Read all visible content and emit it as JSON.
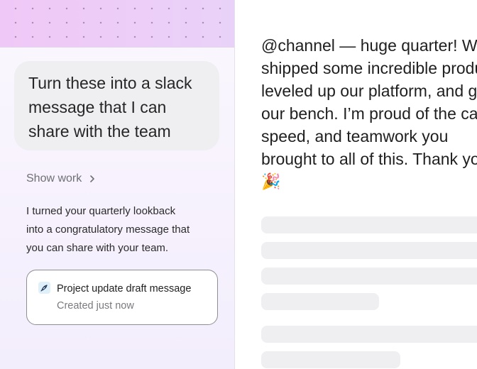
{
  "left": {
    "prompt_lines": [
      "Turn these into a slack",
      "message that I can",
      "share with the team"
    ],
    "show_work_label": "Show work",
    "assistant_lines": [
      "I turned your quarterly lookback",
      "into a congratulatory message that",
      "you can share with your team."
    ],
    "artifact": {
      "title": "Project update draft message",
      "subtitle": "Created just now",
      "icon": "rocket-icon"
    }
  },
  "right": {
    "message_lines": [
      "@channel — huge quarter! We",
      "shipped some incredible products,",
      "leveled up our platform, and grew",
      "our bench. I’m proud of the care,",
      "speed, and teamwork you",
      "brought to all of this. Thank you!",
      "🎉"
    ]
  },
  "colors": {
    "header_gradient": "#efcdf7",
    "bubble": "#efeff2",
    "skeleton": "#efeff1"
  }
}
